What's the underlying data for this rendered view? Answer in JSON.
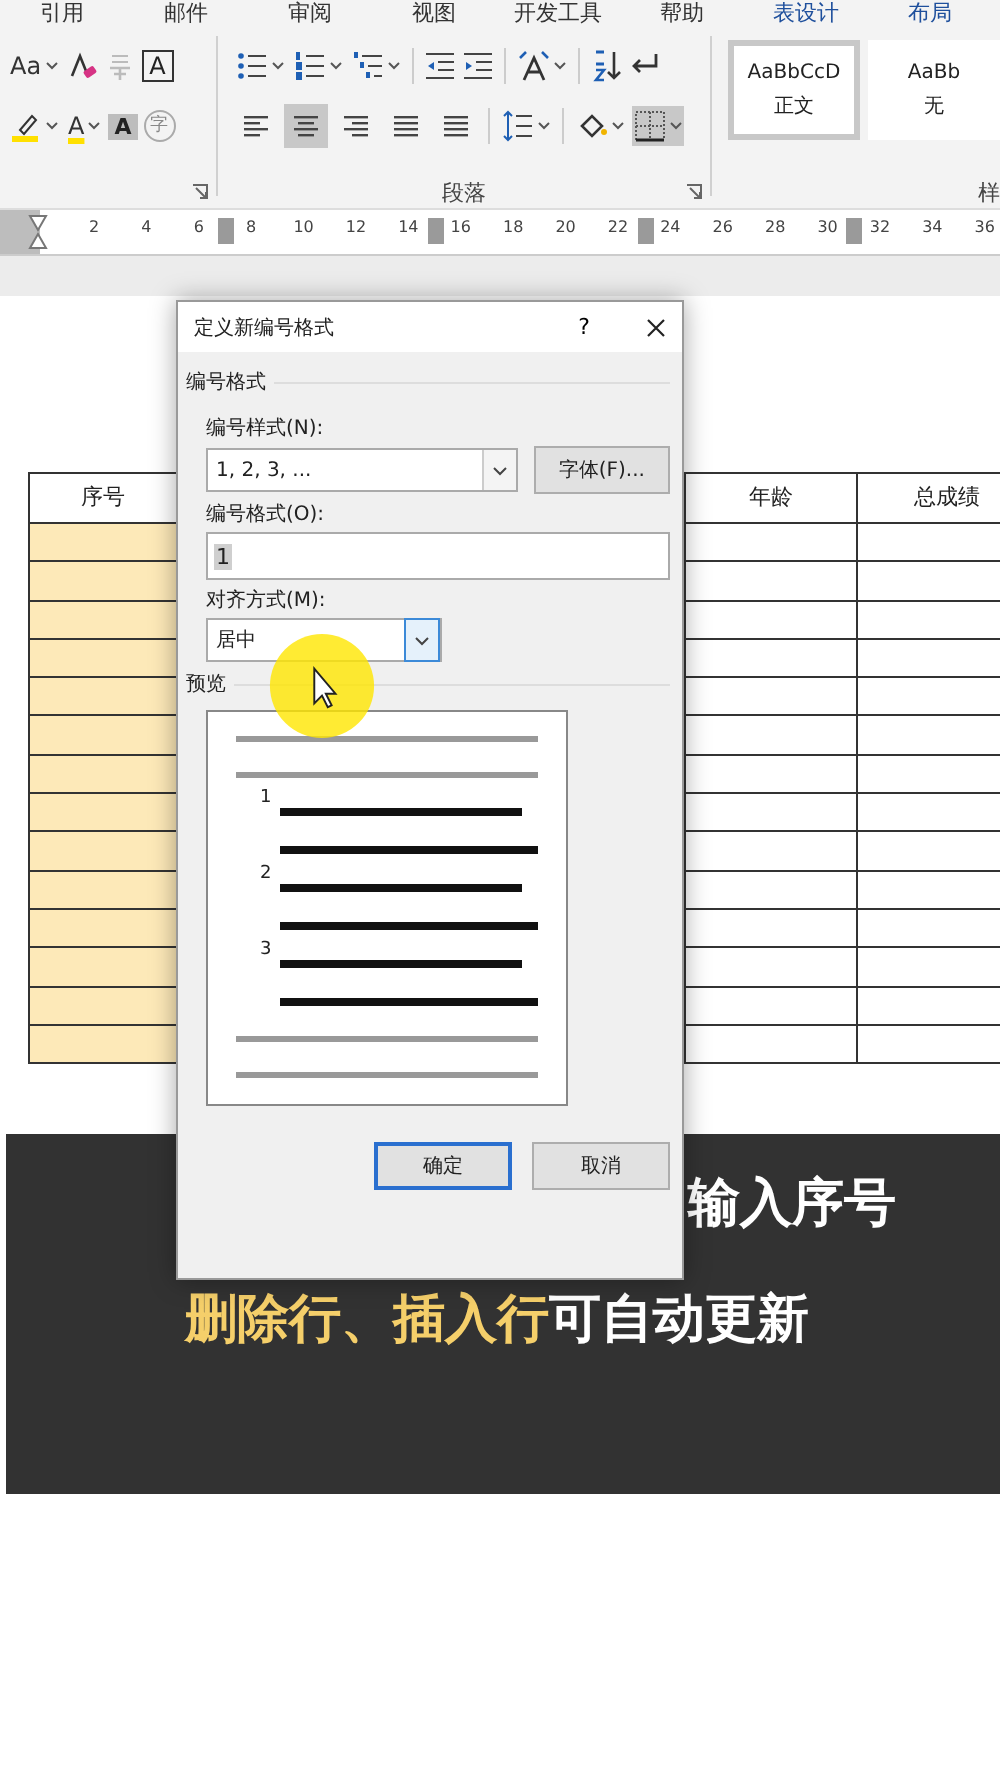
{
  "ribbon_tabs": [
    {
      "label": "引用",
      "selected": false,
      "contextual": false
    },
    {
      "label": "邮件",
      "selected": false,
      "contextual": false
    },
    {
      "label": "审阅",
      "selected": false,
      "contextual": false
    },
    {
      "label": "视图",
      "selected": false,
      "contextual": false
    },
    {
      "label": "开发工具",
      "selected": false,
      "contextual": false
    },
    {
      "label": "帮助",
      "selected": false,
      "contextual": false
    },
    {
      "label": "表设计",
      "selected": false,
      "contextual": true
    },
    {
      "label": "布局",
      "selected": false,
      "contextual": true
    }
  ],
  "font_group": {
    "change_case": "Aa",
    "char_border": "A",
    "font_color": "A",
    "char_shading": "A",
    "enclosed_char": "字"
  },
  "paragraph_group": {
    "label": "段落",
    "alignments": [
      {
        "selected": false
      },
      {
        "selected": true
      },
      {
        "selected": false
      },
      {
        "selected": false
      },
      {
        "selected": false
      }
    ]
  },
  "styles_group": {
    "label": "样",
    "styles": [
      {
        "preview": "AaBbCcD",
        "name": "正文",
        "selected": true
      },
      {
        "preview": "AaBb",
        "name": "无",
        "selected": false
      }
    ]
  },
  "ruler": {
    "numbers": [
      "2",
      "4",
      "6",
      "8",
      "10",
      "12",
      "14",
      "16",
      "18",
      "20",
      "22",
      "24",
      "26",
      "28",
      "30",
      "32",
      "34",
      "36"
    ]
  },
  "table": {
    "columns": [
      {
        "header": "序号",
        "shaded": true
      },
      {
        "header": "年龄",
        "shaded": false
      },
      {
        "header": "总成绩",
        "shaded": false
      }
    ]
  },
  "dialog": {
    "title": "定义新编号格式",
    "help": "?",
    "section_format": "编号格式",
    "style_label": "编号样式(N):",
    "style_value": "1, 2, 3, ...",
    "font_button": "字体(F)...",
    "format_label": "编号格式(O):",
    "format_value": "1",
    "align_label": "对齐方式(M):",
    "align_value": "居中",
    "section_preview": "预览",
    "preview_numbers": [
      "1",
      "2",
      "3"
    ],
    "buttons": [
      {
        "label": "确定",
        "default": true
      },
      {
        "label": "取消",
        "default": false
      }
    ]
  },
  "caption": {
    "lines": [
      {
        "segments": [
          {
            "text": "输入序号",
            "highlight": false
          }
        ]
      },
      {
        "segments": [
          {
            "text": "删除行、插入行",
            "highlight": true
          },
          {
            "text": "可自动更新",
            "highlight": false
          }
        ]
      }
    ]
  }
}
